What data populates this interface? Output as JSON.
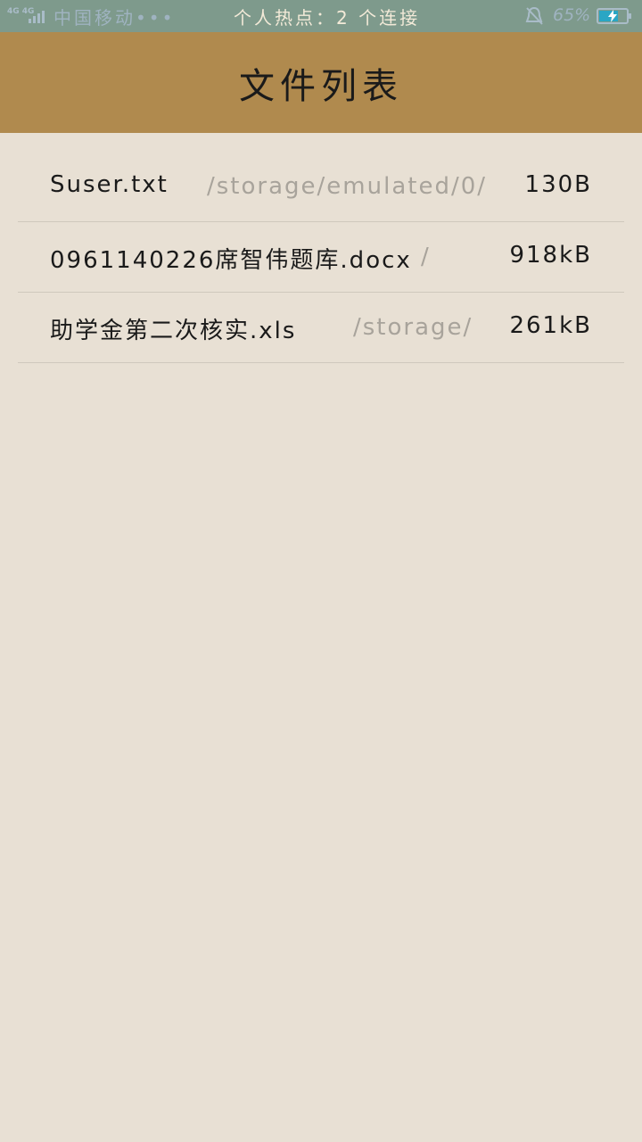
{
  "status_bar": {
    "network": "4G 4G",
    "carrier": "中国移动•••",
    "hotspot": "个人热点：2 个连接",
    "battery_percent": "65%",
    "battery_level": 0.65,
    "icons": [
      "signal-icon",
      "bell-muted-icon",
      "battery-charging-icon"
    ],
    "accent_color": "#2aa6c4"
  },
  "app_bar": {
    "title": "文件列表",
    "color": "#b08a4e"
  },
  "files": [
    {
      "name": "Suser.txt",
      "path": "/storage/emulated/0/",
      "size": "130B"
    },
    {
      "name": "0961140226席智伟题库.docx",
      "path": "/",
      "size": "918kB"
    },
    {
      "name": "助学金第二次核实.xls",
      "path": "/storage/",
      "size": "261kB"
    }
  ]
}
